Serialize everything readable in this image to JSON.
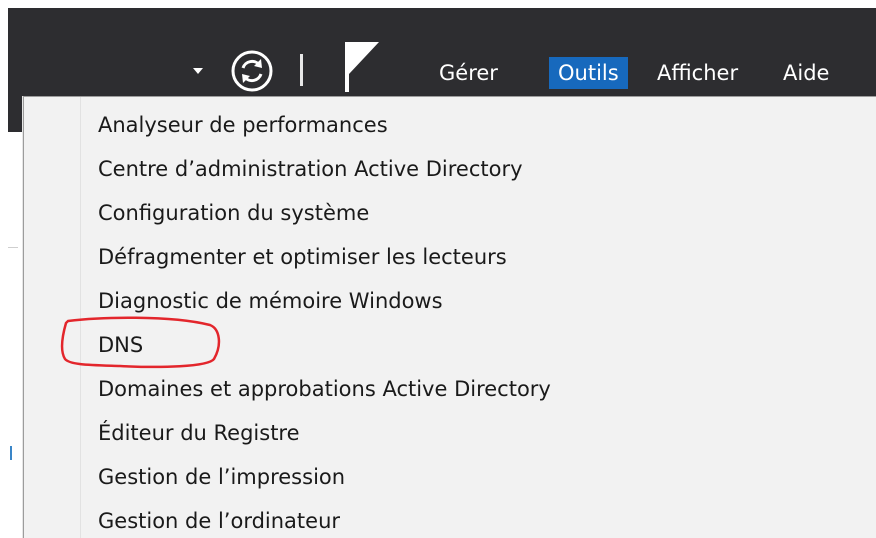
{
  "toolbar": {
    "menu": [
      {
        "label": "Gérer",
        "active": false
      },
      {
        "label": "Outils",
        "active": true
      },
      {
        "label": "Afficher",
        "active": false
      },
      {
        "label": "Aide",
        "active": false
      }
    ],
    "icons": [
      "chevron-down-icon",
      "refresh-icon",
      "flag-icon"
    ]
  },
  "tools_menu": {
    "items": [
      "Analyseur de performances",
      "Centre d’administration Active Directory",
      "Configuration du système",
      "Défragmenter et optimiser les lecteurs",
      "Diagnostic de mémoire Windows",
      "DNS",
      "Domaines et approbations Active Directory",
      "Éditeur du Registre",
      "Gestion de l’impression",
      "Gestion de l’ordinateur"
    ],
    "highlighted_item": "DNS"
  },
  "colors": {
    "topbar_bg": "#2d2d30",
    "active_menu_bg": "#1769bd",
    "menu_bg": "#f2f2f2",
    "annotation": "#e3262c"
  }
}
